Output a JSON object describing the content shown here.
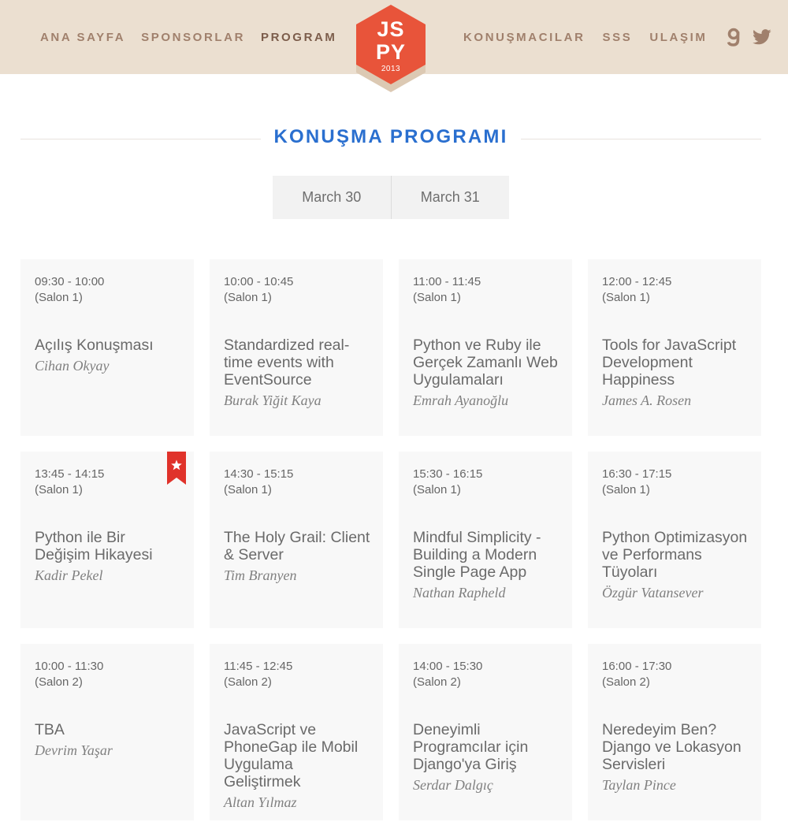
{
  "nav": {
    "left": [
      "ANA SAYFA",
      "SPONSORLAR",
      "PROGRAM"
    ],
    "right": [
      "KONUŞMACILAR",
      "SSS",
      "ULAŞIM"
    ],
    "active": "PROGRAM",
    "social_icons": [
      "gowalla-icon",
      "twitter-icon"
    ]
  },
  "logo": {
    "line1": "JS",
    "line2": "PY",
    "year": "2013"
  },
  "section": {
    "title": "KONUŞMA PROGRAMI"
  },
  "tabs": [
    "March 30",
    "March 31"
  ],
  "colors": {
    "header_bg": "#ebdfd0",
    "nav_text": "#a0806c",
    "title_blue": "#2a6fcf",
    "logo_red": "#e8543a",
    "bookmark_red": "#e0322a",
    "card_bg": "#f8f8f8"
  },
  "sessions": [
    {
      "time": "09:30 - 10:00",
      "room": "(Salon 1)",
      "title": "Açılış Konuşması",
      "speaker": "Cihan Okyay"
    },
    {
      "time": "10:00 - 10:45",
      "room": "(Salon 1)",
      "title": "Standardized real-time events with EventSource",
      "speaker": "Burak Yiğit Kaya"
    },
    {
      "time": "11:00 - 11:45",
      "room": "(Salon 1)",
      "title": "Python ve Ruby ile Gerçek Zamanlı Web Uygulamaları",
      "speaker": "Emrah Ayanoğlu"
    },
    {
      "time": "12:00 - 12:45",
      "room": "(Salon 1)",
      "title": "Tools for JavaScript Development Happiness",
      "speaker": "James A. Rosen"
    },
    {
      "time": "13:45 - 14:15",
      "room": "(Salon 1)",
      "title": "Python ile Bir Değişim Hikayesi",
      "speaker": "Kadir Pekel",
      "bookmarked": true
    },
    {
      "time": "14:30 - 15:15",
      "room": "(Salon 1)",
      "title": "The Holy Grail: Client & Server",
      "speaker": "Tim Branyen"
    },
    {
      "time": "15:30 - 16:15",
      "room": "(Salon 1)",
      "title": "Mindful Simplicity - Building a Modern Single Page App",
      "speaker": "Nathan Rapheld"
    },
    {
      "time": "16:30 - 17:15",
      "room": "(Salon 1)",
      "title": "Python Optimizasyon ve Performans Tüyoları",
      "speaker": "Özgür Vatansever"
    },
    {
      "time": "10:00 - 11:30",
      "room": "(Salon 2)",
      "title": "TBA",
      "speaker": "Devrim Yaşar"
    },
    {
      "time": "11:45 - 12:45",
      "room": "(Salon 2)",
      "title": "JavaScript ve PhoneGap ile Mobil Uygulama Geliştirmek",
      "speaker": "Altan Yılmaz"
    },
    {
      "time": "14:00 - 15:30",
      "room": "(Salon 2)",
      "title": "Deneyimli Programcılar için Django'ya Giriş",
      "speaker": "Serdar Dalgıç"
    },
    {
      "time": "16:00 - 17:30",
      "room": "(Salon 2)",
      "title": "Neredeyim Ben? Django ve Lokasyon Servisleri",
      "speaker": "Taylan Pince"
    }
  ]
}
